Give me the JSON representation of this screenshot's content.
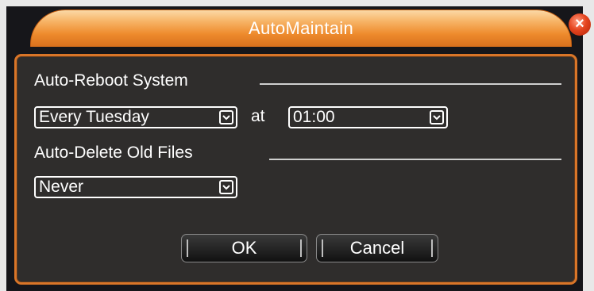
{
  "dialog": {
    "title": "AutoMaintain",
    "close_label": "×"
  },
  "reboot": {
    "section_label": "Auto-Reboot System",
    "frequency_value": "Every Tuesday",
    "at_label": "at",
    "time_value": "01:00"
  },
  "delete": {
    "section_label": "Auto-Delete Old Files",
    "value": "Never"
  },
  "buttons": {
    "ok_label": "OK",
    "cancel_label": "Cancel"
  },
  "colors": {
    "accent": "#e07b2a",
    "panel_bg": "#2f2d2c",
    "close": "#e5451f"
  }
}
